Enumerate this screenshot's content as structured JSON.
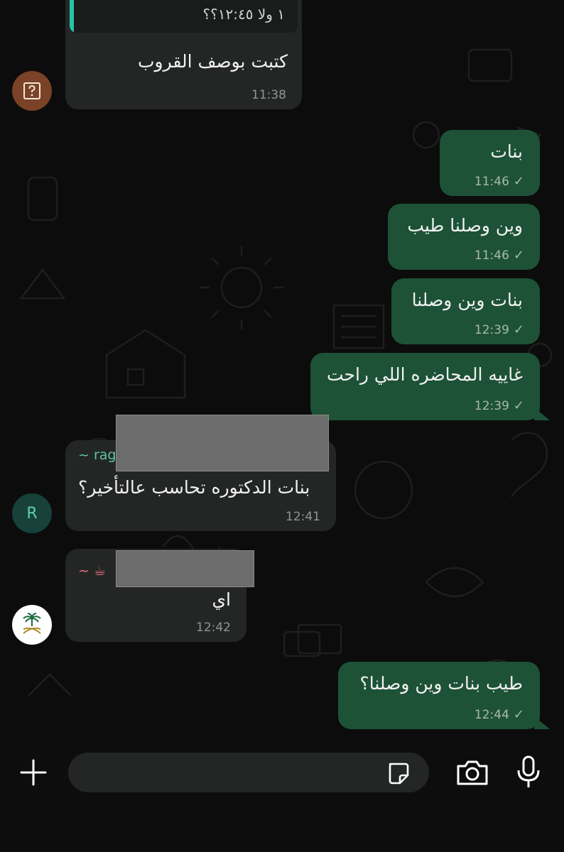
{
  "messages": {
    "m1": {
      "reply_quote": "١ ولا ١٢:٤٥؟؟",
      "text": "كتبت بوصف القروب",
      "time": "11:38",
      "avatar_icon": "question-mark-icon"
    },
    "m2": {
      "text": "بنات",
      "time": "11:46"
    },
    "m3": {
      "text": "وين وصلنا طيب",
      "time": "11:46"
    },
    "m4": {
      "text": "بنات وين وصلنا",
      "time": "12:39"
    },
    "m5": {
      "text": "غاييه المحاضره اللي راحت",
      "time": "12:39"
    },
    "m6": {
      "sender": "~ rag",
      "avatar_letter": "R",
      "text": "بنات الدكتوره تحاسب عالتأخير؟",
      "time": "12:41"
    },
    "m7": {
      "sender": "~ ☕",
      "text": "اي",
      "time": "12:42"
    },
    "m8": {
      "text": "طيب بنات وين وصلنا؟",
      "time": "12:44"
    }
  },
  "colors": {
    "outgoing_bubble": "#1d5237",
    "incoming_bubble": "#242626",
    "accent": "#23c4a6",
    "background": "#0c0c0c"
  },
  "input_bar": {
    "icons": [
      "plus-icon",
      "sticker-icon",
      "camera-icon",
      "microphone-icon"
    ]
  }
}
